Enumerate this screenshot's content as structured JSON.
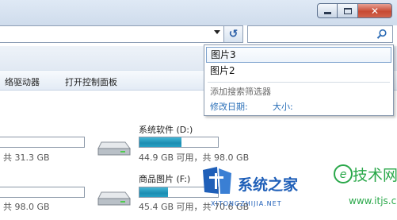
{
  "window": {
    "buttons": {
      "minimize": "",
      "maximize": "",
      "close": "✕"
    }
  },
  "address": {
    "dropdown_icon": "chevron-down-icon"
  },
  "refresh": {
    "label": "↺"
  },
  "search": {
    "value": "",
    "icon": "search-icon"
  },
  "toolbar": {
    "items": [
      "络驱动器",
      "打开控制面板"
    ]
  },
  "dropdown": {
    "items": [
      "图片3",
      "图片2"
    ],
    "hint": "添加搜索筛选器",
    "filters": [
      "修改日期:",
      "大小:"
    ]
  },
  "drives": [
    {
      "name": "",
      "info": "共 31.3 GB",
      "usage_fraction": null
    },
    {
      "name": "系统软件 (D:)",
      "info": "44.9 GB 可用，共 98.0 GB",
      "usage_fraction": 0.54
    },
    {
      "name": "",
      "info": "共 98.0 GB",
      "usage_fraction": null
    },
    {
      "name": "商品图片 (F:)",
      "info": "45.4 GB 可用，共 70.6 GB",
      "usage_fraction": 0.36
    }
  ],
  "watermark": {
    "brand": "系统之家",
    "brand_sub": "XITONGZHIJIA.NET",
    "site": "技术网",
    "url": "www.itjs.cn",
    "colors": {
      "brand_blue": "#1f5fb8",
      "green": "#2aa84a"
    }
  }
}
